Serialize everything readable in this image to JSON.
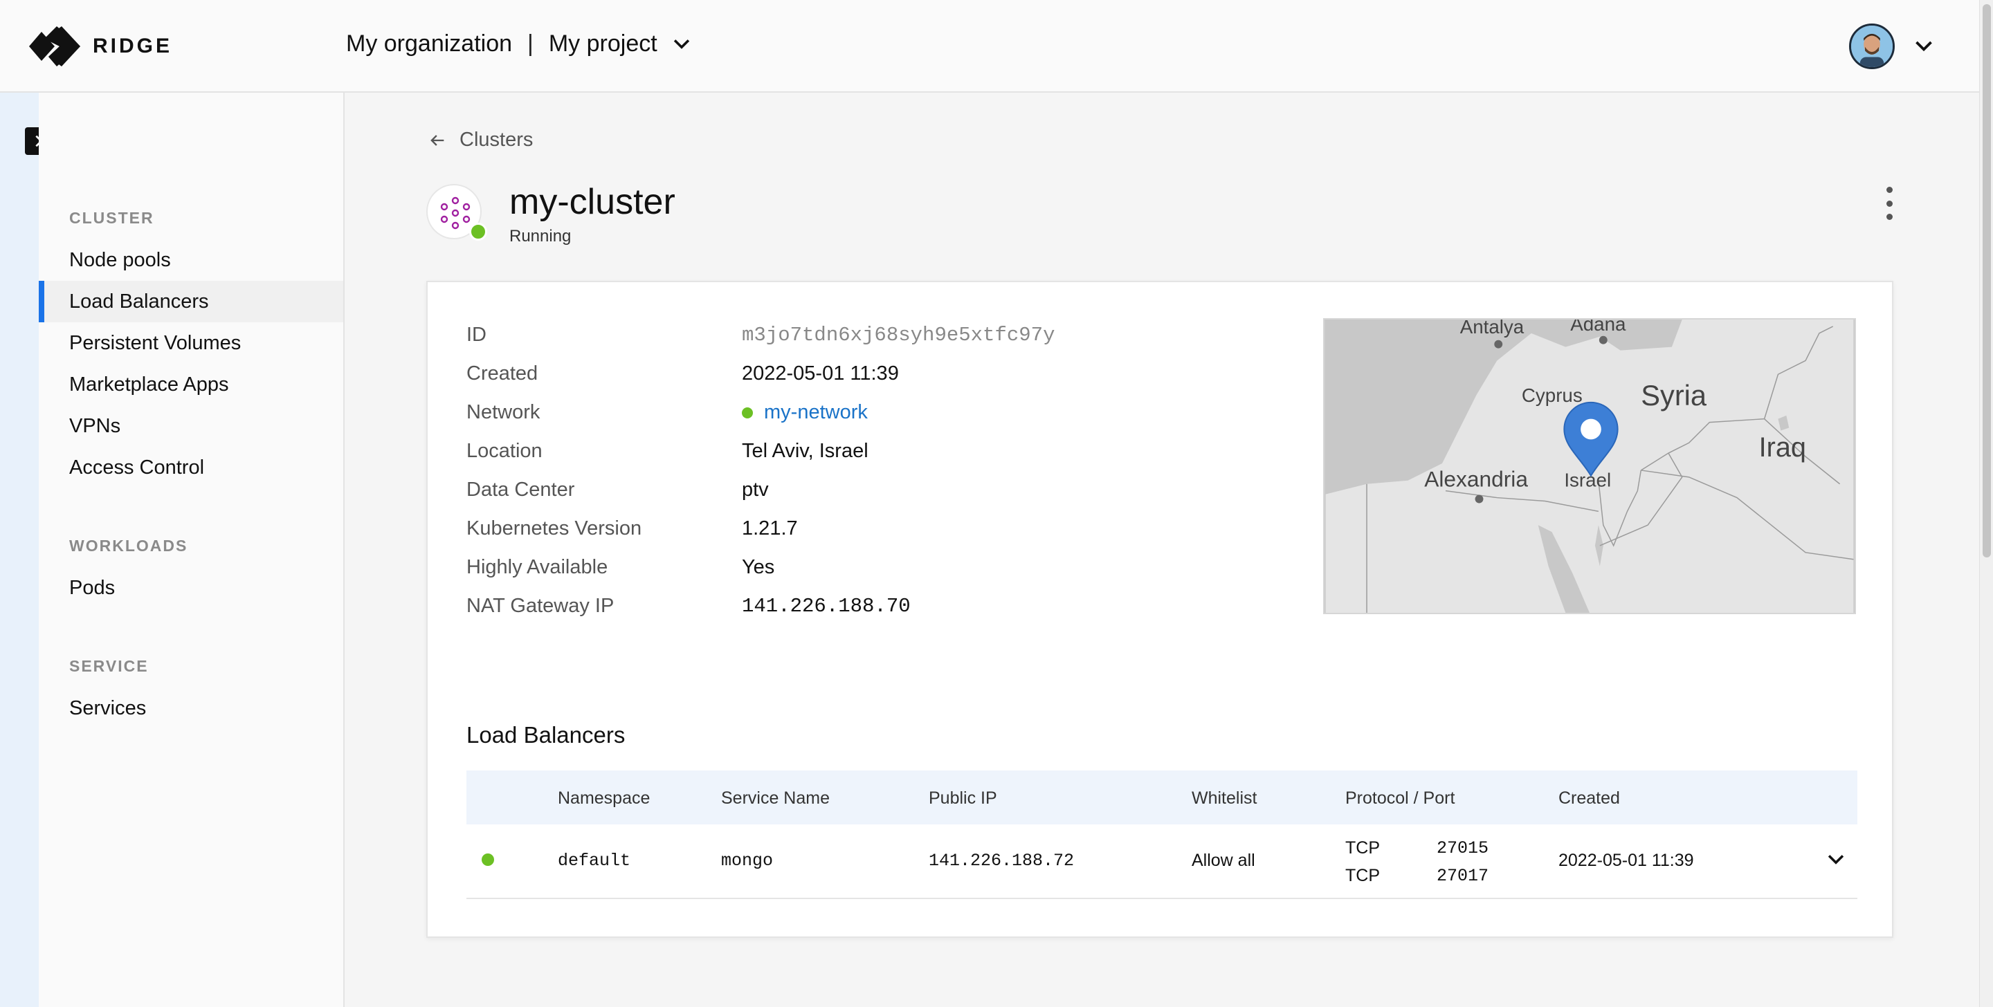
{
  "header": {
    "brand": "RIDGE",
    "organization": "My organization",
    "separator": "|",
    "project": "My project"
  },
  "sidebar": {
    "sections": [
      {
        "title": "CLUSTER",
        "items": [
          "Node pools",
          "Load Balancers",
          "Persistent Volumes",
          "Marketplace Apps",
          "VPNs",
          "Access Control"
        ]
      },
      {
        "title": "WORKLOADS",
        "items": [
          "Pods"
        ]
      },
      {
        "title": "SERVICE",
        "items": [
          "Services"
        ]
      }
    ],
    "active_item": "Load Balancers"
  },
  "breadcrumb": {
    "back_label": "Clusters"
  },
  "cluster": {
    "name": "my-cluster",
    "status": "Running"
  },
  "details": {
    "id": {
      "label": "ID",
      "value": "m3jo7tdn6xj68syh9e5xtfc97y"
    },
    "created": {
      "label": "Created",
      "value": "2022-05-01 11:39"
    },
    "network": {
      "label": "Network",
      "value": "my-network"
    },
    "location": {
      "label": "Location",
      "value": "Tel Aviv, Israel"
    },
    "datacenter": {
      "label": "Data Center",
      "value": "ptv"
    },
    "k8s": {
      "label": "Kubernetes Version",
      "value": "1.21.7"
    },
    "ha": {
      "label": "Highly Available",
      "value": "Yes"
    },
    "nat": {
      "label": "NAT Gateway IP",
      "value": "141.226.188.70"
    }
  },
  "map": {
    "labels": {
      "antalya": "Antalya",
      "adana": "Adana",
      "cyprus": "Cyprus",
      "syria": "Syria",
      "iraq": "Iraq",
      "alexandria": "Alexandria",
      "israel": "Israel"
    }
  },
  "load_balancers": {
    "title": "Load Balancers",
    "columns": {
      "namespace": "Namespace",
      "service_name": "Service Name",
      "public_ip": "Public IP",
      "whitelist": "Whitelist",
      "protocol_port": "Protocol / Port",
      "created": "Created"
    },
    "rows": [
      {
        "namespace": "default",
        "service_name": "mongo",
        "public_ip": "141.226.188.72",
        "whitelist": "Allow all",
        "ports": [
          {
            "protocol": "TCP",
            "port": "27015"
          },
          {
            "protocol": "TCP",
            "port": "27017"
          }
        ],
        "created": "2022-05-01 11:39"
      }
    ]
  },
  "colors": {
    "accent": "#1a73e8",
    "status_green": "#6cc024",
    "link": "#1a73c8",
    "map_pin": "#3d7fd6"
  }
}
